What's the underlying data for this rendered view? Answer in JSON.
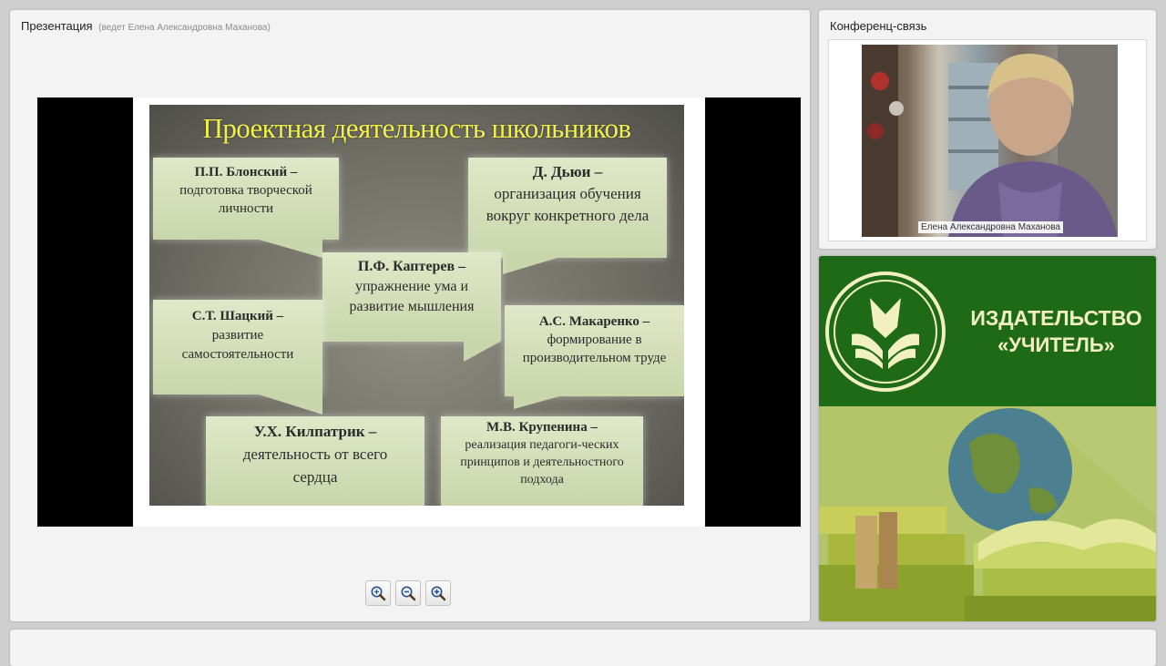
{
  "presentation": {
    "title": "Презентация",
    "presenter_note": "(ведет Елена Александровна Маханова)",
    "slide": {
      "title": "Проектная деятельность школьников",
      "blocks": [
        {
          "name": "П.П. Блонский –",
          "text": "подготовка творческой личности"
        },
        {
          "name": "Д. Дьюи –",
          "text": "организация обучения вокруг конкретного дела"
        },
        {
          "name": "П.Ф. Каптерев –",
          "text": "упражнение ума и развитие мышления"
        },
        {
          "name": "С.Т. Шацкий –",
          "text": "развитие самостоятельности"
        },
        {
          "name": "А.С. Макаренко –",
          "text": "формирование в производительном труде"
        },
        {
          "name": "У.Х. Килпатрик –",
          "text": "деятельность от всего сердца"
        },
        {
          "name": "М.В. Крупенина –",
          "text": "реализация педагоги-ческих принципов и деятельностного подхода"
        }
      ]
    },
    "zoom_buttons": [
      {
        "icon": "zoom-reset-icon"
      },
      {
        "icon": "zoom-out-icon"
      },
      {
        "icon": "zoom-in-icon"
      }
    ]
  },
  "conference": {
    "title": "Конференц-связь",
    "participant_name": "Елена Александровна Маханова"
  },
  "ad": {
    "brand_line1": "ИЗДАТЕЛЬСТВО",
    "brand_line2": "«УЧИТЕЛЬ»",
    "colors": {
      "background": "#1e6a17",
      "text": "#f2f0c0"
    }
  }
}
